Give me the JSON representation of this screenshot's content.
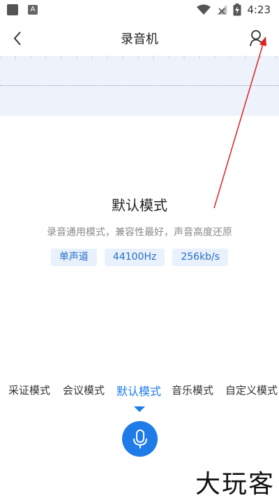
{
  "status_bar": {
    "time": "4:23",
    "notification_icon": "a-icon",
    "icons": [
      "wifi-icon",
      "no-signal-icon",
      "battery-charging-icon"
    ]
  },
  "header": {
    "title": "录音机",
    "back_icon": "chevron-left-icon",
    "action_icon": "sound-output-icon"
  },
  "mode": {
    "name": "默认模式",
    "description": "录音通用模式，兼容性最好，声音高度还原",
    "tags": [
      "单声道",
      "44100Hz",
      "256kb/s"
    ]
  },
  "tabs": [
    {
      "label": "采证模式"
    },
    {
      "label": "会议模式"
    },
    {
      "label": "默认模式",
      "active": true
    },
    {
      "label": "音乐模式"
    },
    {
      "label": "自定义模式"
    }
  ],
  "record_button_icon": "microphone-icon",
  "watermark": "大玩客",
  "colors": {
    "accent": "#1e7be8",
    "tag_bg": "#e8f1fc",
    "wave_bg": "#eef2fa",
    "annotation_arrow": "#e02020"
  }
}
